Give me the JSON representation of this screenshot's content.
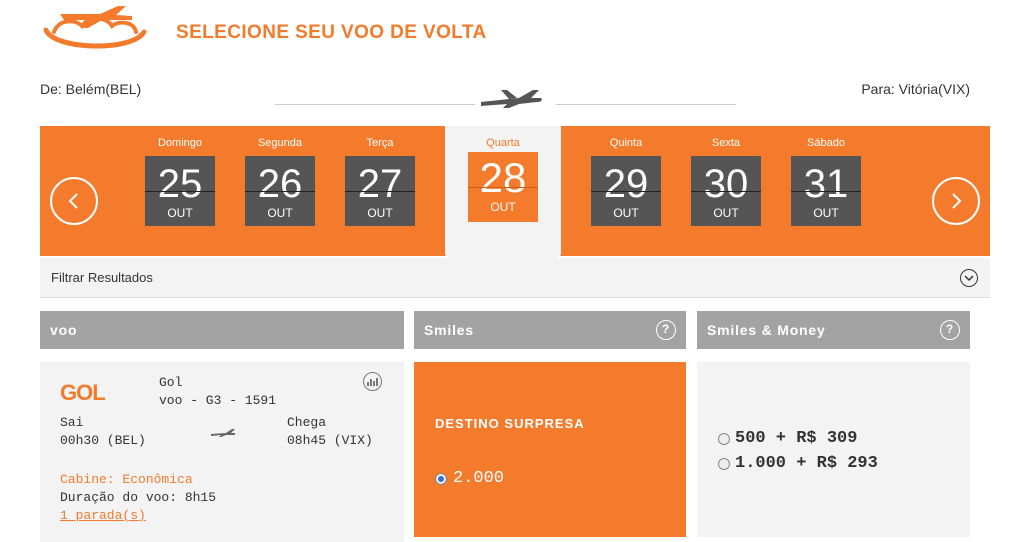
{
  "header": {
    "title": "SELECIONE SEU VOO DE VOLTA",
    "brand_color": "#f47a2c"
  },
  "route": {
    "from": "De: Belém(BEL)",
    "to": "Para: Vitória(VIX)"
  },
  "dates": [
    {
      "weekday": "Domingo",
      "day": "25",
      "month": "OUT",
      "selected": false
    },
    {
      "weekday": "Segunda",
      "day": "26",
      "month": "OUT",
      "selected": false
    },
    {
      "weekday": "Terça",
      "day": "27",
      "month": "OUT",
      "selected": false
    },
    {
      "weekday": "Quarta",
      "day": "28",
      "month": "OUT",
      "selected": true
    },
    {
      "weekday": "Quinta",
      "day": "29",
      "month": "OUT",
      "selected": false
    },
    {
      "weekday": "Sexta",
      "day": "30",
      "month": "OUT",
      "selected": false
    },
    {
      "weekday": "Sábado",
      "day": "31",
      "month": "OUT",
      "selected": false
    }
  ],
  "filter": {
    "label": "Filtrar Resultados"
  },
  "columns": {
    "voo": "voo",
    "smiles": "Smiles",
    "smiles_money": "Smiles & Money",
    "help": "?"
  },
  "flight": {
    "logo_text": "GOL",
    "airline": "Gol",
    "code": "voo - G3 - 1591",
    "depart_label": "Sai",
    "depart_time": "00h30 (BEL)",
    "arrive_label": "Chega",
    "arrive_time": "08h45 (VIX)",
    "cabin": "Cabine: Econômica",
    "duration": "Duração do voo: 8h15",
    "stops": "1 parada(s)"
  },
  "smiles": {
    "title": "DESTINO SURPRESA",
    "miles": "2.000"
  },
  "smiles_money": {
    "options": [
      "500 + R$ 309",
      "1.000 + R$ 293"
    ]
  }
}
